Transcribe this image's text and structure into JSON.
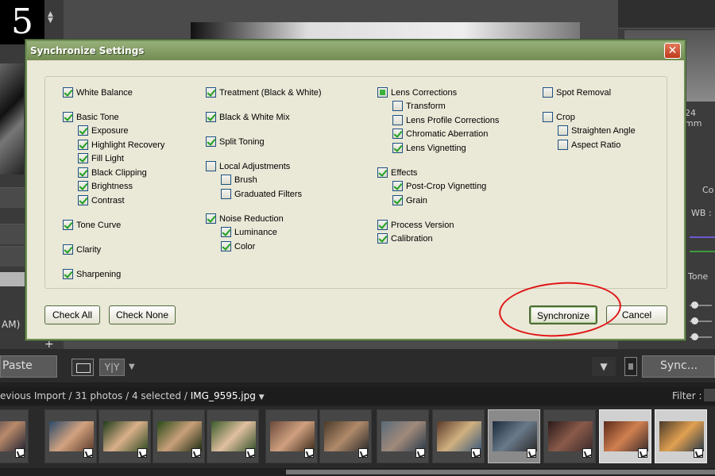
{
  "step_number": "5",
  "background": {
    "left_panel": {
      "time_suffix": "AM)",
      "add_icon": "plus-icon"
    },
    "right_panel": {
      "focal_length": "24 mm",
      "label_co": "Co",
      "label_wb": "WB :",
      "label_tone": "Tone"
    },
    "toolbar": {
      "paste_label": "Paste",
      "view_toggle_label": "Y|Y",
      "sync_label": "Sync..."
    },
    "filmstrip": {
      "breadcrumb_prefix": "evious Import / 31 photos / 4 selected /",
      "current_file": "IMG_9595.jpg",
      "filter_label": "Filter :",
      "thumbnail_count": 13
    }
  },
  "dialog": {
    "title": "Synchronize Settings",
    "columns": [
      {
        "items": [
          {
            "label": "White Balance",
            "checked": true
          },
          {
            "label": "Basic Tone",
            "checked": true
          },
          {
            "label": "Exposure",
            "checked": true,
            "indent": 1
          },
          {
            "label": "Highlight Recovery",
            "checked": true,
            "indent": 1
          },
          {
            "label": "Fill Light",
            "checked": true,
            "indent": 1
          },
          {
            "label": "Black Clipping",
            "checked": true,
            "indent": 1
          },
          {
            "label": "Brightness",
            "checked": true,
            "indent": 1
          },
          {
            "label": "Contrast",
            "checked": true,
            "indent": 1
          },
          {
            "label": "Tone Curve",
            "checked": true
          },
          {
            "label": "Clarity",
            "checked": true
          },
          {
            "label": "Sharpening",
            "checked": true
          }
        ]
      },
      {
        "items": [
          {
            "label": "Treatment (Black & White)",
            "checked": true
          },
          {
            "label": "Black & White Mix",
            "checked": true
          },
          {
            "label": "Split Toning",
            "checked": true
          },
          {
            "label": "Local Adjustments",
            "checked": false
          },
          {
            "label": "Brush",
            "checked": false,
            "indent": 1
          },
          {
            "label": "Graduated Filters",
            "checked": false,
            "indent": 1
          },
          {
            "label": "Noise Reduction",
            "checked": true
          },
          {
            "label": "Luminance",
            "checked": true,
            "indent": 1
          },
          {
            "label": "Color",
            "checked": true,
            "indent": 1
          }
        ]
      },
      {
        "items": [
          {
            "label": "Lens Corrections",
            "checked": "partial"
          },
          {
            "label": "Transform",
            "checked": false,
            "indent": 1
          },
          {
            "label": "Lens Profile Corrections",
            "checked": false,
            "indent": 1
          },
          {
            "label": "Chromatic Aberration",
            "checked": true,
            "indent": 1
          },
          {
            "label": "Lens Vignetting",
            "checked": true,
            "indent": 1
          },
          {
            "label": "Effects",
            "checked": true
          },
          {
            "label": "Post-Crop Vignetting",
            "checked": true,
            "indent": 1
          },
          {
            "label": "Grain",
            "checked": true,
            "indent": 1
          },
          {
            "label": "Process Version",
            "checked": true
          },
          {
            "label": "Calibration",
            "checked": true
          }
        ]
      },
      {
        "items": [
          {
            "label": "Spot Removal",
            "checked": false
          },
          {
            "label": "Crop",
            "checked": false
          },
          {
            "label": "Straighten Angle",
            "checked": false,
            "indent": 1
          },
          {
            "label": "Aspect Ratio",
            "checked": false,
            "indent": 1
          }
        ]
      }
    ],
    "buttons": {
      "check_all": "Check All",
      "check_none": "Check None",
      "synchronize": "Synchronize",
      "cancel": "Cancel"
    },
    "close_icon": "close-icon",
    "highlight_color": "#e01515"
  }
}
